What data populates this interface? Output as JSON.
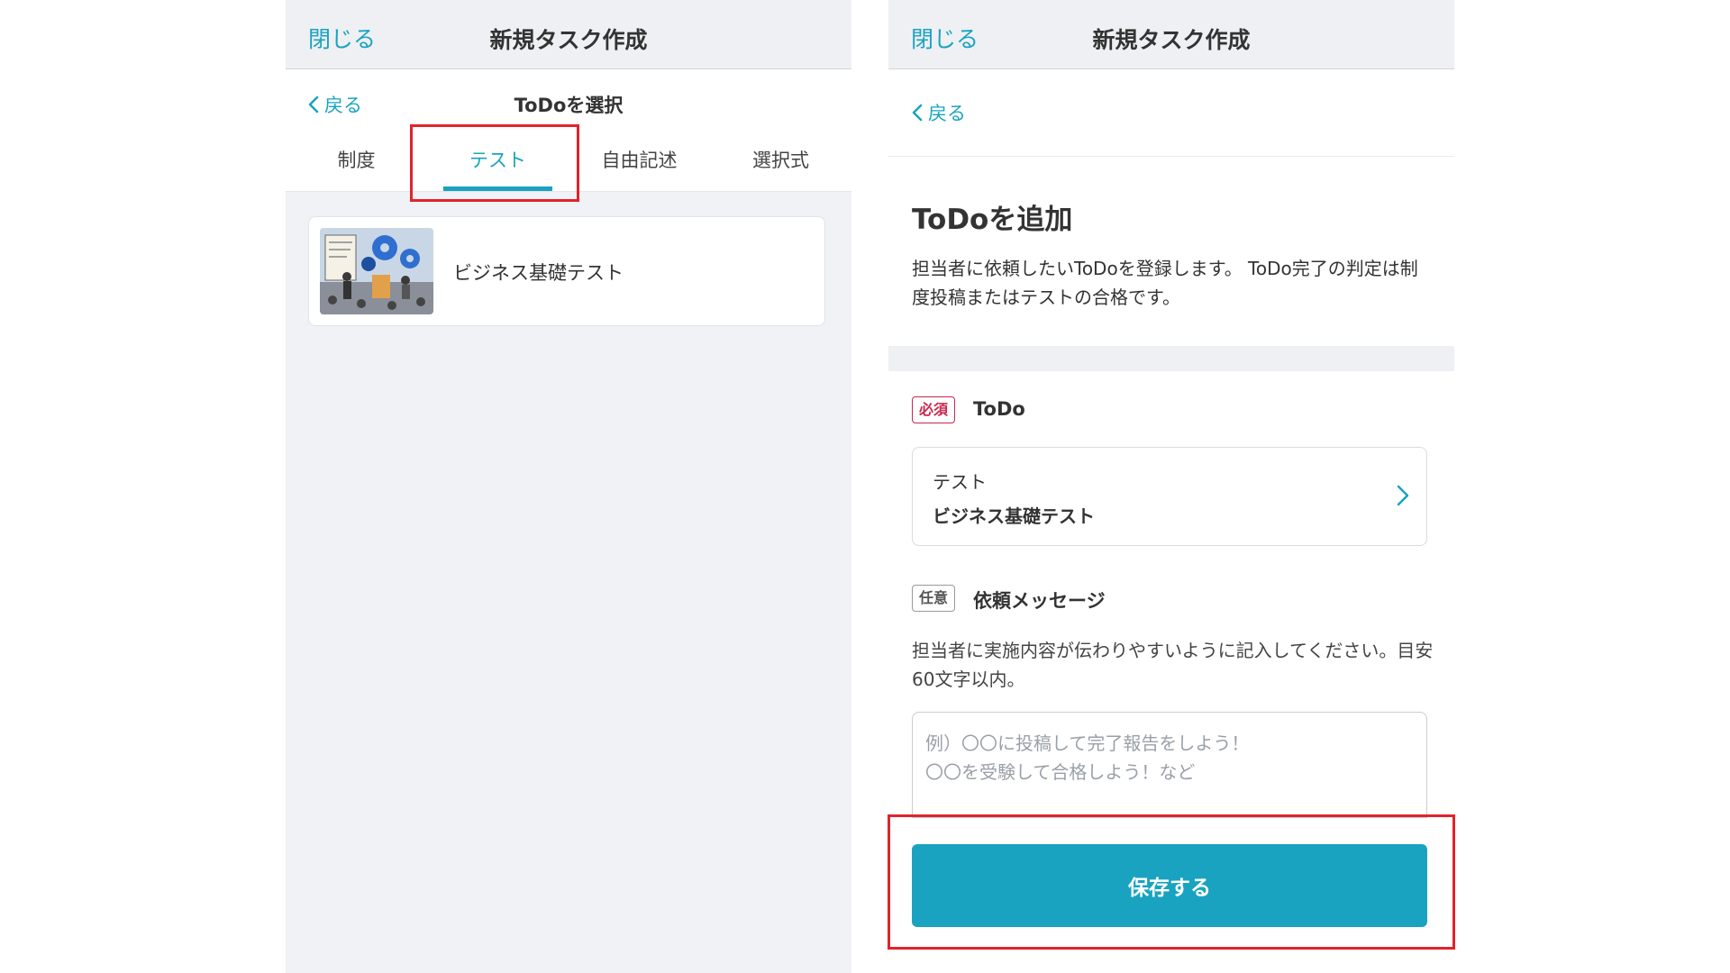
{
  "left_screen": {
    "header": {
      "close_label": "閉じる",
      "title": "新規タスク作成"
    },
    "subnav": {
      "back_label": "戻る",
      "title": "ToDoを選択"
    },
    "tabs": [
      {
        "label": "制度",
        "active": false
      },
      {
        "label": "テスト",
        "active": true
      },
      {
        "label": "自由記述",
        "active": false
      },
      {
        "label": "選択式",
        "active": false
      }
    ],
    "items": [
      {
        "label": "ビジネス基礎テスト",
        "thumbnail": "business-meeting-illustration"
      }
    ]
  },
  "right_screen": {
    "header": {
      "close_label": "閉じる",
      "title": "新規タスク作成"
    },
    "back_label": "戻る",
    "heading": "ToDoを追加",
    "description": "担当者に依頼したいToDoを登録します。 ToDo完了の判定は制度投稿またはテストの合格です。",
    "todo_field": {
      "badge": "必須",
      "label": "ToDo",
      "selected_type": "テスト",
      "selected_name": "ビジネス基礎テスト"
    },
    "message_field": {
      "badge": "任意",
      "label": "依頼メッセージ",
      "help": "担当者に実施内容が伝わりやすいように記入してください。目安60文字以内。",
      "placeholder": "例）〇〇に投稿して完了報告をしよう！\n〇〇を受験して合格しよう！など",
      "value": ""
    },
    "save_label": "保存する"
  },
  "colors": {
    "accent": "#19a3c1",
    "highlight": "#e2232a",
    "required": "#c8284f",
    "header_bg": "#eef0f3"
  }
}
